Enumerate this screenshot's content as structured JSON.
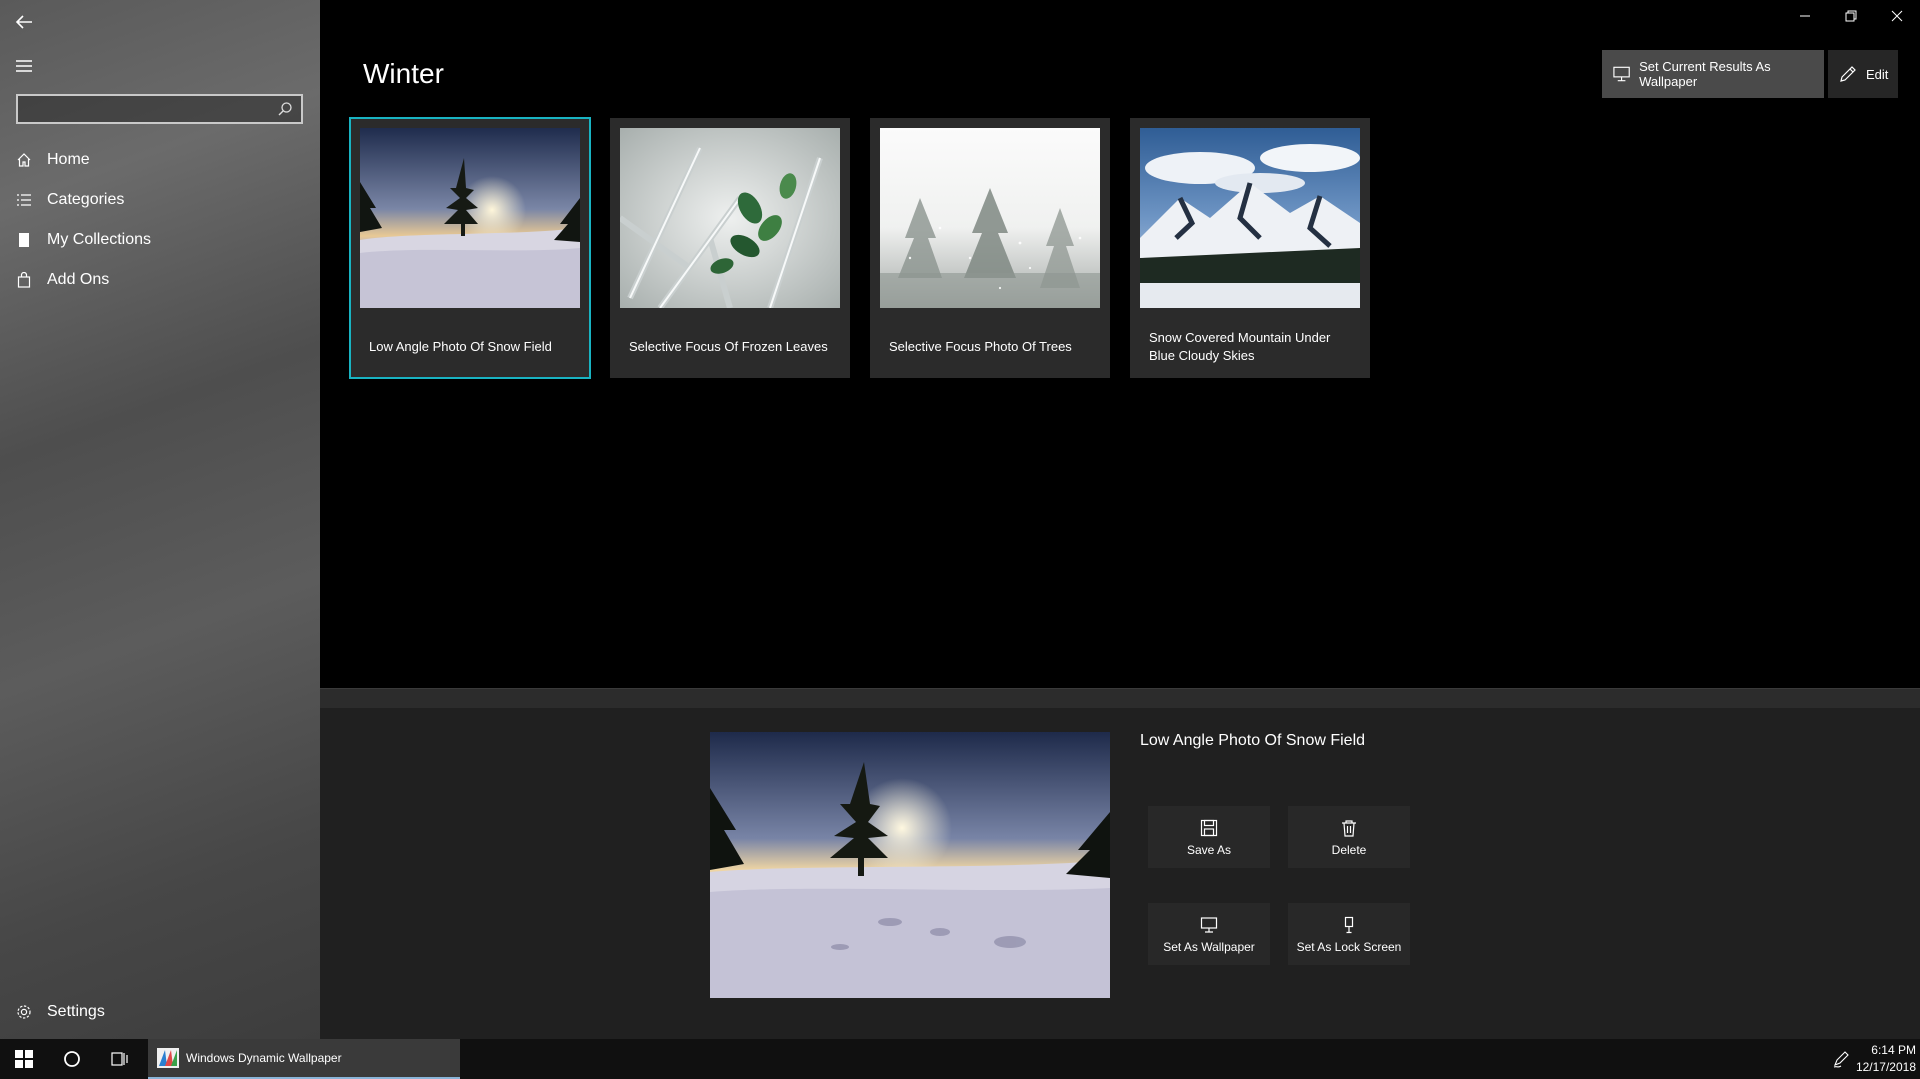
{
  "window": {
    "minimize_glyph": "—",
    "restore_glyph": "❐",
    "close_glyph": "✕"
  },
  "sidebar": {
    "search": {
      "value": "",
      "placeholder": ""
    },
    "items": [
      {
        "label": "Home",
        "icon": "home-icon"
      },
      {
        "label": "Categories",
        "icon": "list-icon"
      },
      {
        "label": "My Collections",
        "icon": "bookmark-icon"
      },
      {
        "label": "Add Ons",
        "icon": "bag-icon"
      }
    ],
    "settings_label": "Settings"
  },
  "main": {
    "title": "Winter",
    "toolbar": {
      "set_wallpaper_label": "Set Current Results As Wallpaper",
      "edit_label": "Edit"
    },
    "cards": [
      {
        "label": "Low Angle Photo Of Snow Field"
      },
      {
        "label": "Selective Focus Of Frozen Leaves"
      },
      {
        "label": "Selective Focus Photo Of Trees"
      },
      {
        "label": "Snow Covered Mountain Under Blue Cloudy Skies"
      }
    ]
  },
  "detail": {
    "title": "Low Angle Photo Of Snow Field",
    "actions": {
      "save_as": "Save As",
      "delete": "Delete",
      "set_wallpaper": "Set As Wallpaper",
      "set_lock_screen": "Set As Lock Screen"
    }
  },
  "taskbar": {
    "app_label": "Windows Dynamic Wallpaper",
    "time": "6:14 PM",
    "date": "12/17/2018"
  },
  "colors": {
    "accent": "#19b3c2",
    "background": "#000000",
    "panel": "#202020"
  }
}
